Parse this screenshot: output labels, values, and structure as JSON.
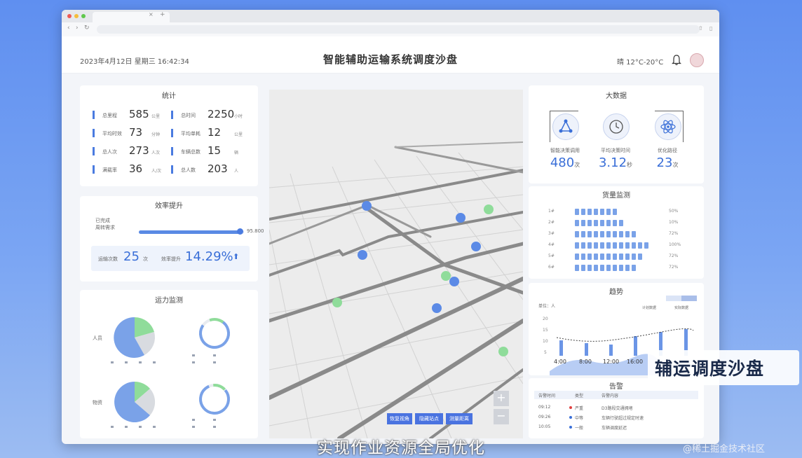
{
  "header": {
    "datetime": "2023年4月12日  星期三  16:42:34",
    "title": "智能辅助运输系统调度沙盘",
    "weather": "晴  12°C-20°C"
  },
  "stats": {
    "title": "统计",
    "items": [
      {
        "label": "总里程",
        "value": "585",
        "unit": "公里"
      },
      {
        "label": "总时间",
        "value": "2250",
        "unit": "小时"
      },
      {
        "label": "平均时效",
        "value": "73",
        "unit": "分钟"
      },
      {
        "label": "平均单耗",
        "value": "12",
        "unit": "公里"
      },
      {
        "label": "总人次",
        "value": "273",
        "unit": "人次"
      },
      {
        "label": "车辆总数",
        "value": "15",
        "unit": "辆"
      },
      {
        "label": "满载率",
        "value": "36",
        "unit": "人/次"
      },
      {
        "label": "总人数",
        "value": "203",
        "unit": "人"
      }
    ]
  },
  "efficiency": {
    "title": "效率提升",
    "slider_label": "已完成\n周转需求",
    "slider_end": "95.800",
    "slider_fraction": 0.96,
    "trips_label": "运输次数",
    "trips_value": "25",
    "trips_unit": "次",
    "improve_label": "效率提升",
    "improve_value": "14.29%",
    "improve_arrow": "⬆"
  },
  "capacity": {
    "title": "运力监测",
    "row1_label": "人员",
    "row2_label": "物资",
    "legend": [
      "—",
      "—",
      "—",
      "—"
    ]
  },
  "map": {
    "buttons": [
      "恢复视角",
      "隐藏站点",
      "测量距离"
    ],
    "zoom_in": "+",
    "zoom_out": "−"
  },
  "big_data": {
    "title": "大数据",
    "items": [
      {
        "label": "智能决策调用",
        "value": "480",
        "unit": "次"
      },
      {
        "label": "平均决策时间",
        "value": "3.12",
        "unit": "秒"
      },
      {
        "label": "优化路径",
        "value": "23",
        "unit": "次"
      }
    ]
  },
  "warehouse": {
    "title": "货量监测",
    "rows": [
      {
        "label": "1#",
        "filled": 7,
        "pct": "50%"
      },
      {
        "label": "2#",
        "filled": 8,
        "pct": "10%"
      },
      {
        "label": "3#",
        "filled": 10,
        "pct": "72%"
      },
      {
        "label": "4#",
        "filled": 12,
        "pct": "100%"
      },
      {
        "label": "5#",
        "filled": 11,
        "pct": "72%"
      },
      {
        "label": "6#",
        "filled": 10,
        "pct": "72%"
      }
    ]
  },
  "trend": {
    "title": "趋势",
    "ylabel": "单位：人",
    "yticks": [
      "20",
      "15",
      "10",
      "5"
    ],
    "xticks": [
      "4:00",
      "8:00",
      "12:00",
      "16:00"
    ],
    "legend_a": "计划数据",
    "legend_b": "实际数据"
  },
  "alerts": {
    "title": "告警",
    "headers": [
      "告警时间",
      "类型",
      "告警内容"
    ],
    "rows": [
      {
        "time": "09:12",
        "type": "严重",
        "content": "D3路段交通拥堵",
        "color": "#e04040"
      },
      {
        "time": "09:26",
        "type": "中等",
        "content": "车辆行驶超过规定时速",
        "color": "#3a6fd8"
      },
      {
        "time": "10:05",
        "type": "一般",
        "content": "车辆调度延迟",
        "color": "#3a6fd8"
      }
    ]
  },
  "overlay_text": "辅运调度沙盘",
  "subtitle": "实现作业资源全局优化",
  "watermark": "@稀土掘金技术社区",
  "colors": {
    "accent": "#4a7be0",
    "green": "#8fdc9a",
    "map_bg": "#ececec"
  }
}
